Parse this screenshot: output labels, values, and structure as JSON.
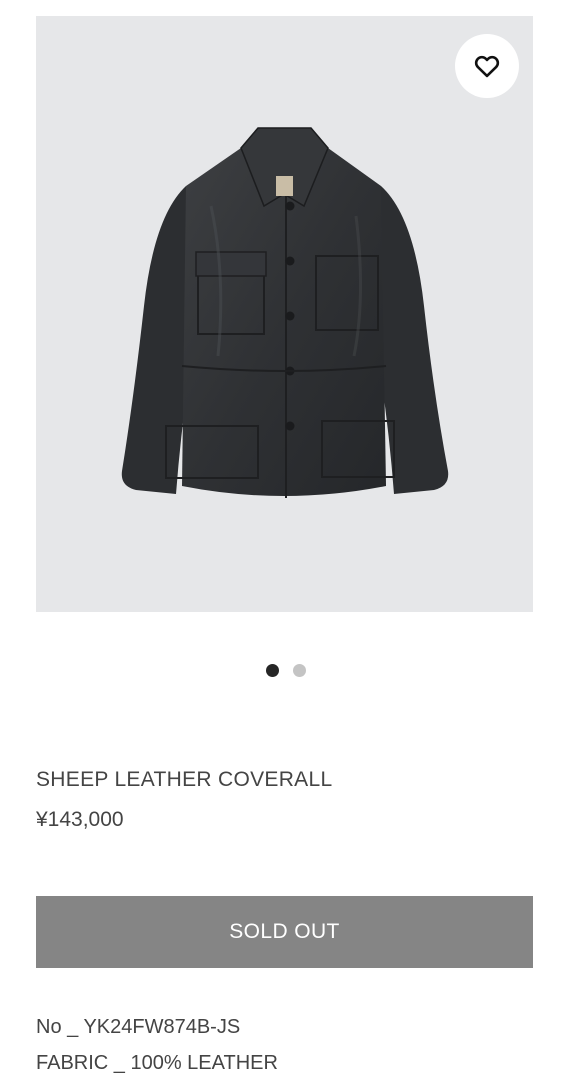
{
  "product": {
    "name": "SHEEP LEATHER COVERALL",
    "price": "¥143,000",
    "image_alt": "Black sheep leather coverall jacket",
    "button_label": "SOLD OUT",
    "details": {
      "no": "No _ YK24FW874B-JS",
      "fabric": "FABRIC _ 100% LEATHER"
    }
  },
  "carousel": {
    "total": 2,
    "active_index": 0
  },
  "icons": {
    "wishlist": "heart-icon"
  },
  "colors": {
    "image_background": "#e6e7e9",
    "button_background": "#858585",
    "dot_active": "#262626",
    "dot_inactive": "#c4c4c4"
  }
}
